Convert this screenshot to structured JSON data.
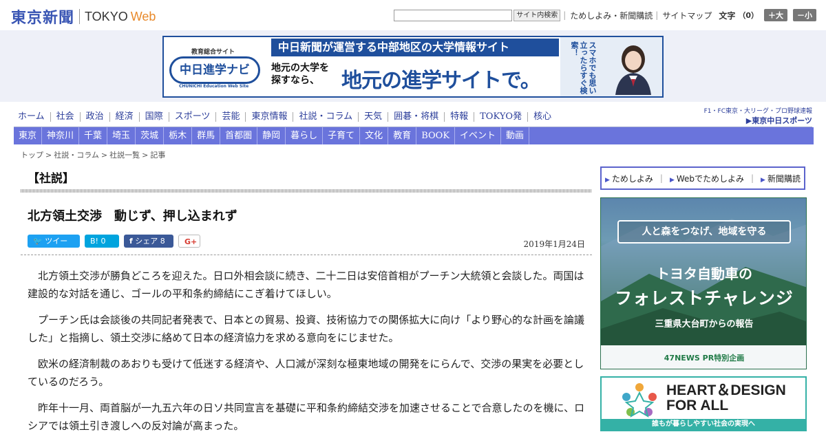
{
  "header": {
    "logo_jp": "東京新聞",
    "logo_tokyo": "TOKYO",
    "logo_web": "Web",
    "search_placeholder": "",
    "search_button": "サイト内検索",
    "link_trial": "ためしよみ・新聞購読",
    "link_sitemap": "サイトマップ",
    "font_size_label": "文字",
    "font_size_value": "（0）",
    "size_up": "＋大",
    "size_down": "－小"
  },
  "top_banner": {
    "tag": "教育総合サイト",
    "logo": "中日進学ナビ",
    "logo_sub": "CHUNICHI Education Web Site",
    "headline": "中日新聞が運営する中部地区の大学情報サイト",
    "small_copy": "地元の大学を\n探すなら、",
    "big_copy": "地元の進学サイトで。",
    "vertical_copy": "スマホでも思い立ったらすぐ検索！"
  },
  "main_nav": {
    "items": [
      "ホーム",
      "社会",
      "政治",
      "経済",
      "国際",
      "スポーツ",
      "芸能",
      "東京情報",
      "社説・コラム",
      "天気",
      "囲碁・将棋",
      "特報",
      "TOKYO発",
      "核心"
    ],
    "sports_line1": "F1・FC東京・大リーグ・プロ野球速報",
    "sports_line2": "▶東京中日スポーツ"
  },
  "sub_nav": {
    "items": [
      "東京",
      "神奈川",
      "千葉",
      "埼玉",
      "茨城",
      "栃木",
      "群馬",
      "首都圏",
      "静岡",
      "暮らし",
      "子育て",
      "文化",
      "教育",
      "BOOK",
      "イベント",
      "動画"
    ]
  },
  "breadcrumb": {
    "items": [
      "トップ",
      "社説・コラム",
      "社説一覧",
      "記事"
    ],
    "separator": ">"
  },
  "article": {
    "section": "【社説】",
    "headline": "北方領土交渉　動じず、押し込まれず",
    "date": "2019年1月24日",
    "share": {
      "tweet": "ツイート",
      "hatena": "B! 0",
      "facebook": "シェア 8",
      "gplus": "G+"
    },
    "paragraphs": [
      "北方領土交渉が勝負どころを迎えた。日ロ外相会談に続き、二十二日は安倍首相がプーチン大統領と会談した。両国は建設的な対話を通じ、ゴールの平和条約締結にこぎ着けてほしい。",
      "プーチン氏は会談後の共同記者発表で、日本との貿易、投資、技術協力での関係拡大に向け「より野心的な計画を論議した」と指摘し、領土交渉に絡めて日本の経済協力を求める意向をにじませた。",
      "欧米の経済制裁のあおりも受けて低迷する経済や、人口減が深刻な極東地域の開発をにらんで、交渉の果実を必要としているのだろう。",
      "昨年十一月、両首脳が一九五六年の日ソ共同宣言を基礎に平和条約締結交渉を加速させることで合意したのを機に、ロシアでは領土引き渡しへの反対論が高まった。"
    ]
  },
  "sidebar": {
    "subscribe": {
      "item1": "ためしよみ",
      "item2": "Webでためしよみ",
      "item3": "新聞購読"
    },
    "forest_ad": {
      "ribbon": "人と森をつなげ、地域を守る",
      "line1": "トヨタ自動車の",
      "line2": "フォレストチャレンジ",
      "line3": "三重県大台町からの報告",
      "footer": "47NEWS PR特別企画"
    },
    "heart_ad": {
      "line1": "HEART＆DESIGN",
      "line2": "FOR ALL",
      "footer": "誰もが暮らしやすい社会の実現へ"
    }
  },
  "colors": {
    "brand_blue": "#3a56b4",
    "subnav": "#6a74dc",
    "web_orange": "#e8892a"
  }
}
